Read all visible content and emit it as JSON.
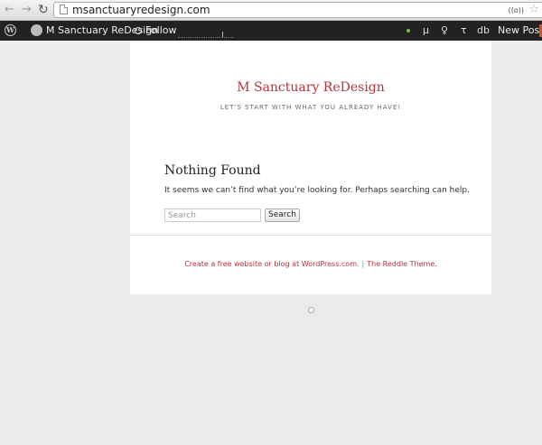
{
  "browser": {
    "url": "msanctuaryredesign.com",
    "extension_label": "((o))"
  },
  "admin_bar": {
    "wp_logo_glyph": "W",
    "site_name": "M Sanctuary ReDesign",
    "follow_label": "Follow",
    "mu_glyph": "μ",
    "bulb_glyph": "♀",
    "tau_glyph": "τ",
    "db_label": "db",
    "new_post_label": "New Post",
    "colors": {
      "status_dot": "#6fbe3b",
      "accent_orange": "#d54e21"
    }
  },
  "site": {
    "title": "M Sanctuary ReDesign",
    "tagline": "LET'S START WITH WHAT YOU ALREADY HAVE!",
    "accent_color": "#b5323b"
  },
  "content": {
    "heading": "Nothing Found",
    "message": "It seems we can’t find what you’re looking for. Perhaps searching can help.",
    "search_placeholder": "Search",
    "search_value": "",
    "search_button_label": "Search"
  },
  "footer": {
    "wordpress_link": "Create a free website or blog at WordPress.com.",
    "separator": "|",
    "theme_link": "The Reddle Theme."
  }
}
